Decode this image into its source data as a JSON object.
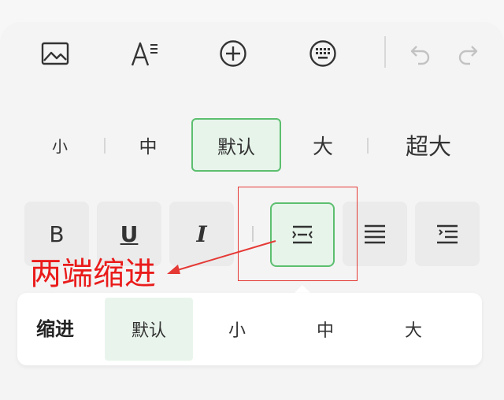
{
  "toolbar": {
    "icons": [
      "image-icon",
      "text-format-icon",
      "add-circle-icon",
      "keyboard-icon",
      "undo-icon",
      "redo-icon"
    ]
  },
  "font_size": {
    "options": [
      "小",
      "中",
      "默认",
      "大",
      "超大"
    ],
    "selected": "默认"
  },
  "format": {
    "bold_label": "B",
    "underline_label": "U",
    "italic_label": "I",
    "selected": "justify"
  },
  "annotation": {
    "text": "两端缩进",
    "color": "#ea1b1b"
  },
  "indent_popup": {
    "title": "缩进",
    "options": [
      "默认",
      "小",
      "中",
      "大"
    ],
    "selected": "默认"
  },
  "colors": {
    "accent": "#5cbf6f",
    "selected_bg": "#e6f4ea",
    "annotation_red": "#e53935"
  }
}
